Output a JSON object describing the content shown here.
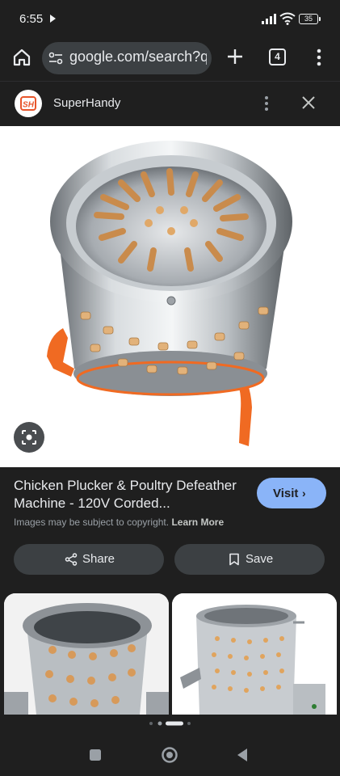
{
  "status_bar": {
    "time": "6:55",
    "battery": "35"
  },
  "browser": {
    "url": "google.com/search?q",
    "tab_count": "4"
  },
  "source": {
    "logo_text": "SH",
    "name": "SuperHandy"
  },
  "result": {
    "title": "Chicken Plucker & Poultry Defeather Machine - 120V Corded...",
    "visit_label": "Visit",
    "copyright_text": "Images may be subject to copyright.",
    "learn_more": "Learn More"
  },
  "actions": {
    "share_label": "Share",
    "save_label": "Save"
  },
  "colors": {
    "accent": "#8ab4f8",
    "background": "#1f1f1f",
    "button": "#3c4043",
    "machine_leg": "#f06a22"
  },
  "icons": [
    "home-icon",
    "tune-icon",
    "plus-icon",
    "tabs-icon",
    "more-vert-icon",
    "close-icon",
    "lens-icon",
    "share-icon",
    "bookmark-icon",
    "chevron-right-icon",
    "square-icon",
    "circle-icon",
    "back-triangle-icon"
  ]
}
